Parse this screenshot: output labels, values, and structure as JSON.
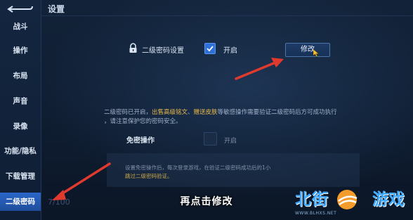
{
  "window": {
    "title": "设置"
  },
  "sidebar": {
    "items": [
      {
        "label": "战斗"
      },
      {
        "label": "操作"
      },
      {
        "label": "布局"
      },
      {
        "label": "声音"
      },
      {
        "label": "录像"
      },
      {
        "label": "功能/隐私"
      },
      {
        "label": "下载管理"
      },
      {
        "label": "二级密码"
      }
    ]
  },
  "password_row": {
    "label": "二级密码设置",
    "checked": true,
    "enable_label": "开启",
    "modify_button": "修改"
  },
  "notice": {
    "part1": "二级密码已开启，",
    "hl1": "出售高级铭文",
    "part2": "、",
    "hl2": "赠送皮肤",
    "part3": "等敏感操作需要验证二级密码后方可成功执行",
    "line2": "，请注意保护您的密码安全。"
  },
  "free_op": {
    "label": "免密操作",
    "checked": false,
    "enable_label": "开启"
  },
  "lower_note": {
    "line1": "设置免密操作后，每次登录游戏，在验证二级密码成功后的1小",
    "line2": "跳过二级密码验证。"
  },
  "page_number": "7/100",
  "subtitle": "再点击修改",
  "watermark": {
    "brand": "北街",
    "game": "游戏",
    "url": "WWW.BLHXS.NET"
  },
  "colors": {
    "accent": "#2a66c8",
    "highlight": "#e9b949",
    "arrow": "#e03a2f"
  },
  "icons": [
    "back-icon",
    "lock-icon",
    "check-icon",
    "cursor-icon",
    "arrow-icon"
  ]
}
